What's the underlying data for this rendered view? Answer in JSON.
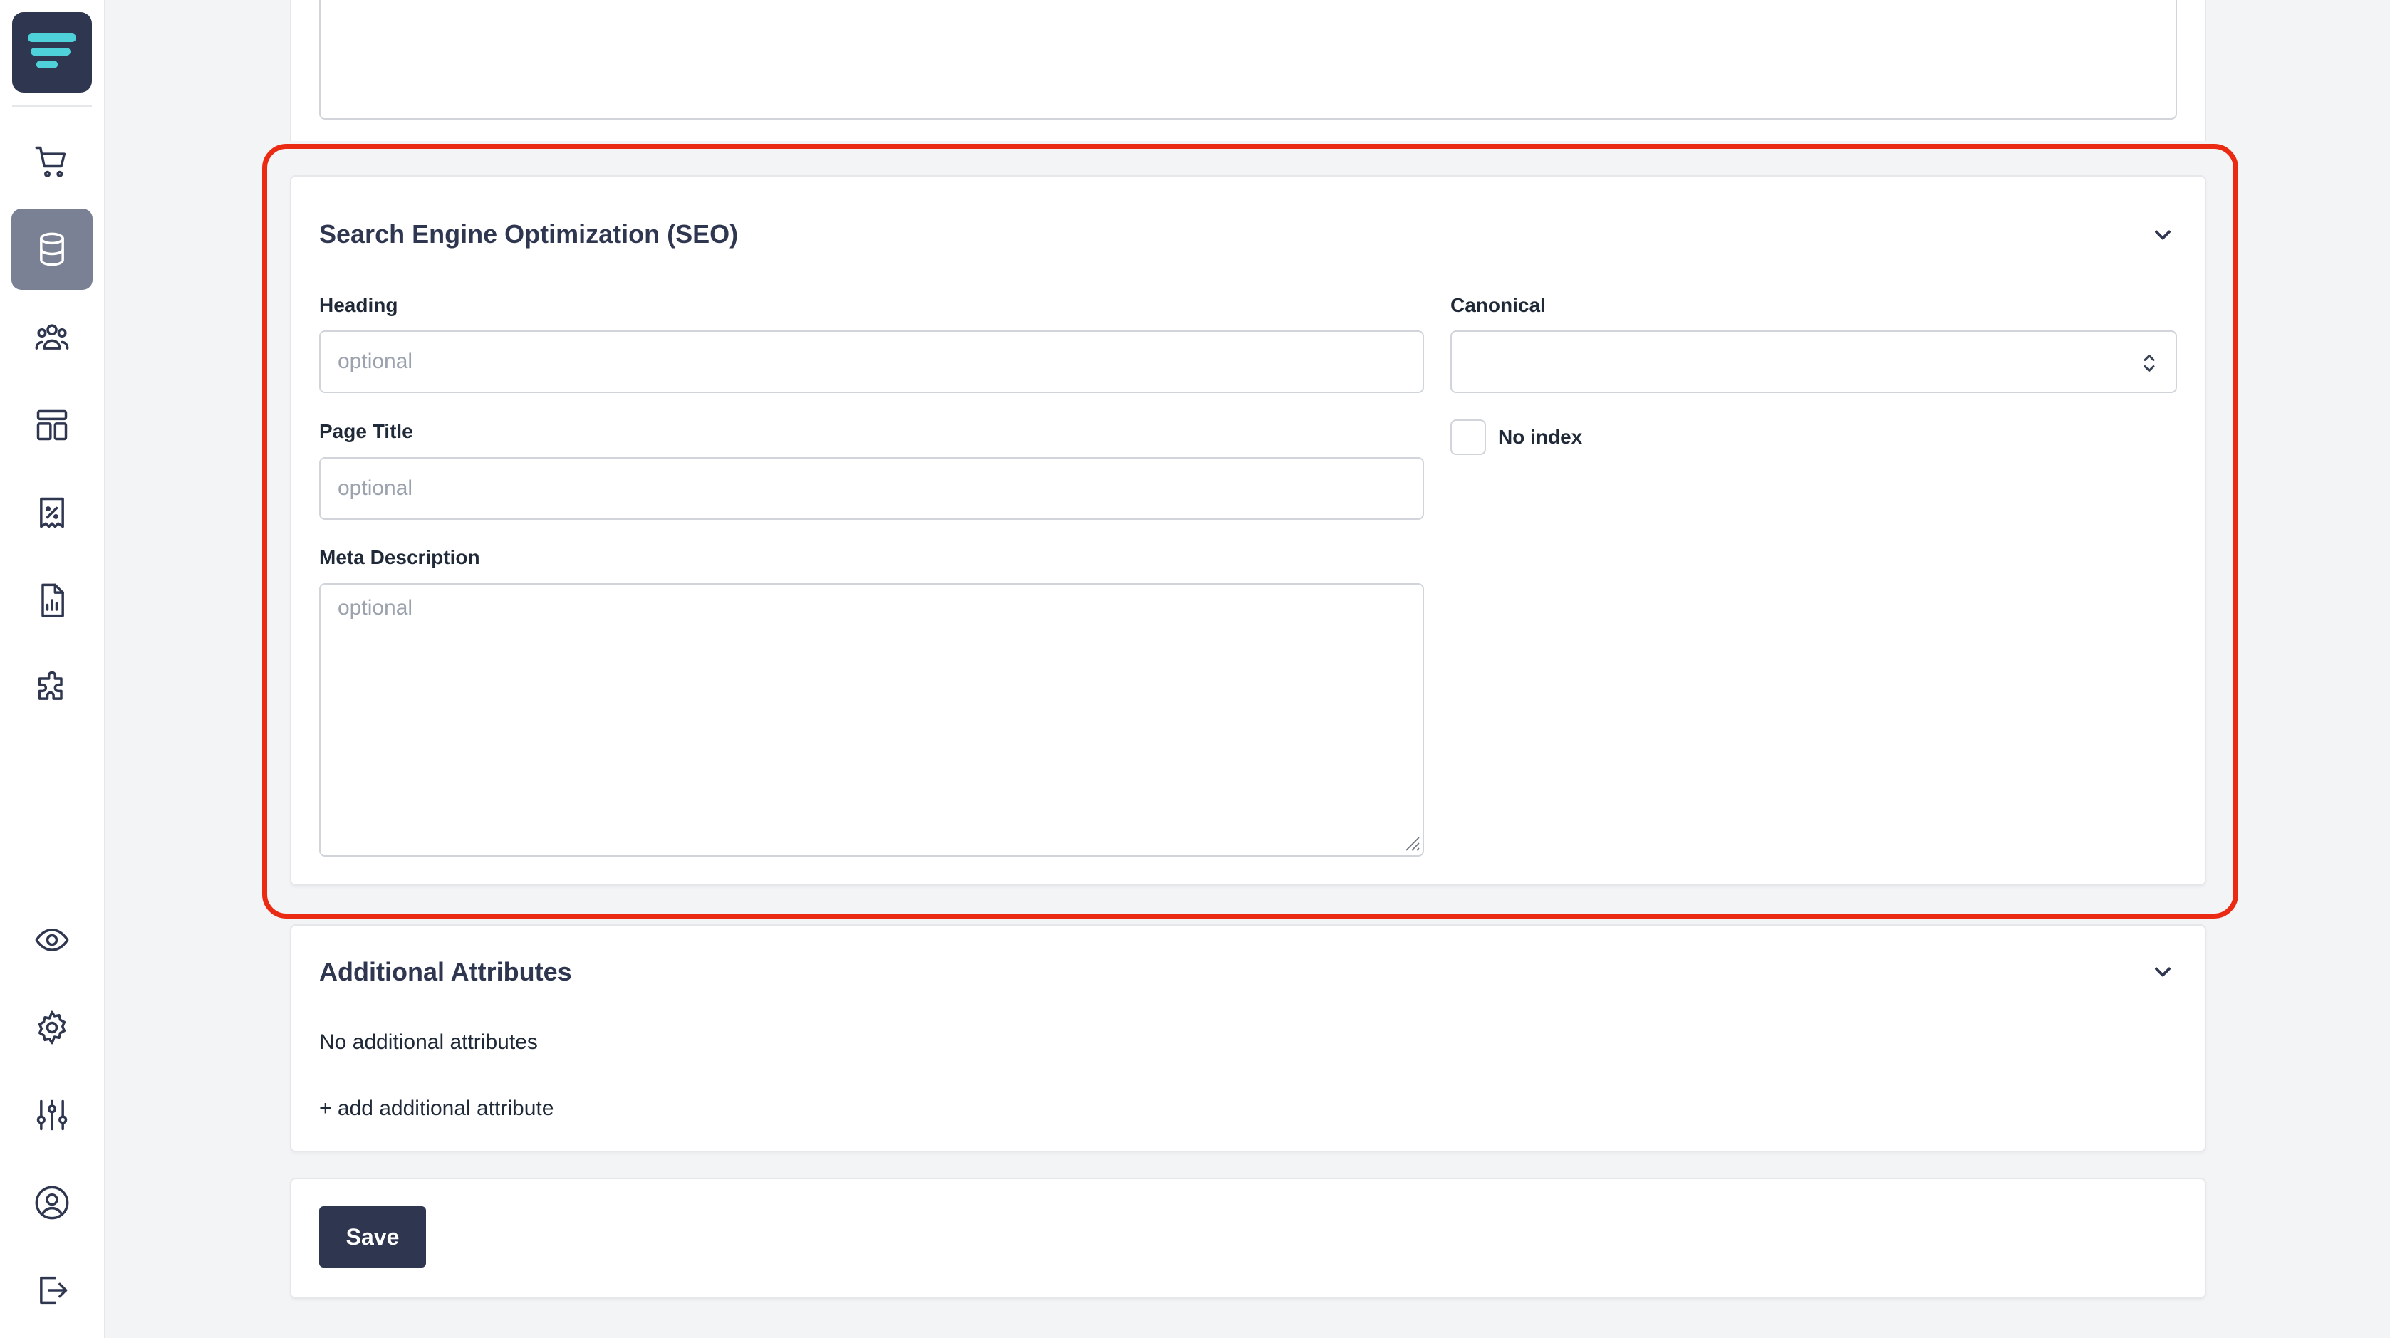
{
  "seo": {
    "title": "Search Engine Optimization (SEO)",
    "heading_label": "Heading",
    "heading_placeholder": "optional",
    "heading_value": "",
    "page_title_label": "Page Title",
    "page_title_placeholder": "optional",
    "page_title_value": "",
    "meta_description_label": "Meta Description",
    "meta_description_placeholder": "optional",
    "meta_description_value": "",
    "canonical_label": "Canonical",
    "canonical_value": "",
    "no_index_label": "No index",
    "no_index_checked": false
  },
  "additional_attributes": {
    "title": "Additional Attributes",
    "empty_text": "No additional attributes",
    "add_link": "+ add additional attribute"
  },
  "actions": {
    "save_label": "Save"
  },
  "sidebar": {
    "items": [
      {
        "icon": "cart-icon"
      },
      {
        "icon": "database-icon",
        "active": true
      },
      {
        "icon": "users-icon"
      },
      {
        "icon": "layout-icon"
      },
      {
        "icon": "receipt-percent-icon"
      },
      {
        "icon": "report-icon"
      },
      {
        "icon": "puzzle-icon"
      },
      {
        "icon": "eye-icon"
      },
      {
        "icon": "gear-icon"
      },
      {
        "icon": "sliders-icon"
      },
      {
        "icon": "user-circle-icon"
      },
      {
        "icon": "logout-icon"
      }
    ]
  },
  "colors": {
    "brand": "#2f3650",
    "highlight": "#ea2a12",
    "logo_accent": "#4fd1d9",
    "sidebar_active": "#7a8194"
  }
}
